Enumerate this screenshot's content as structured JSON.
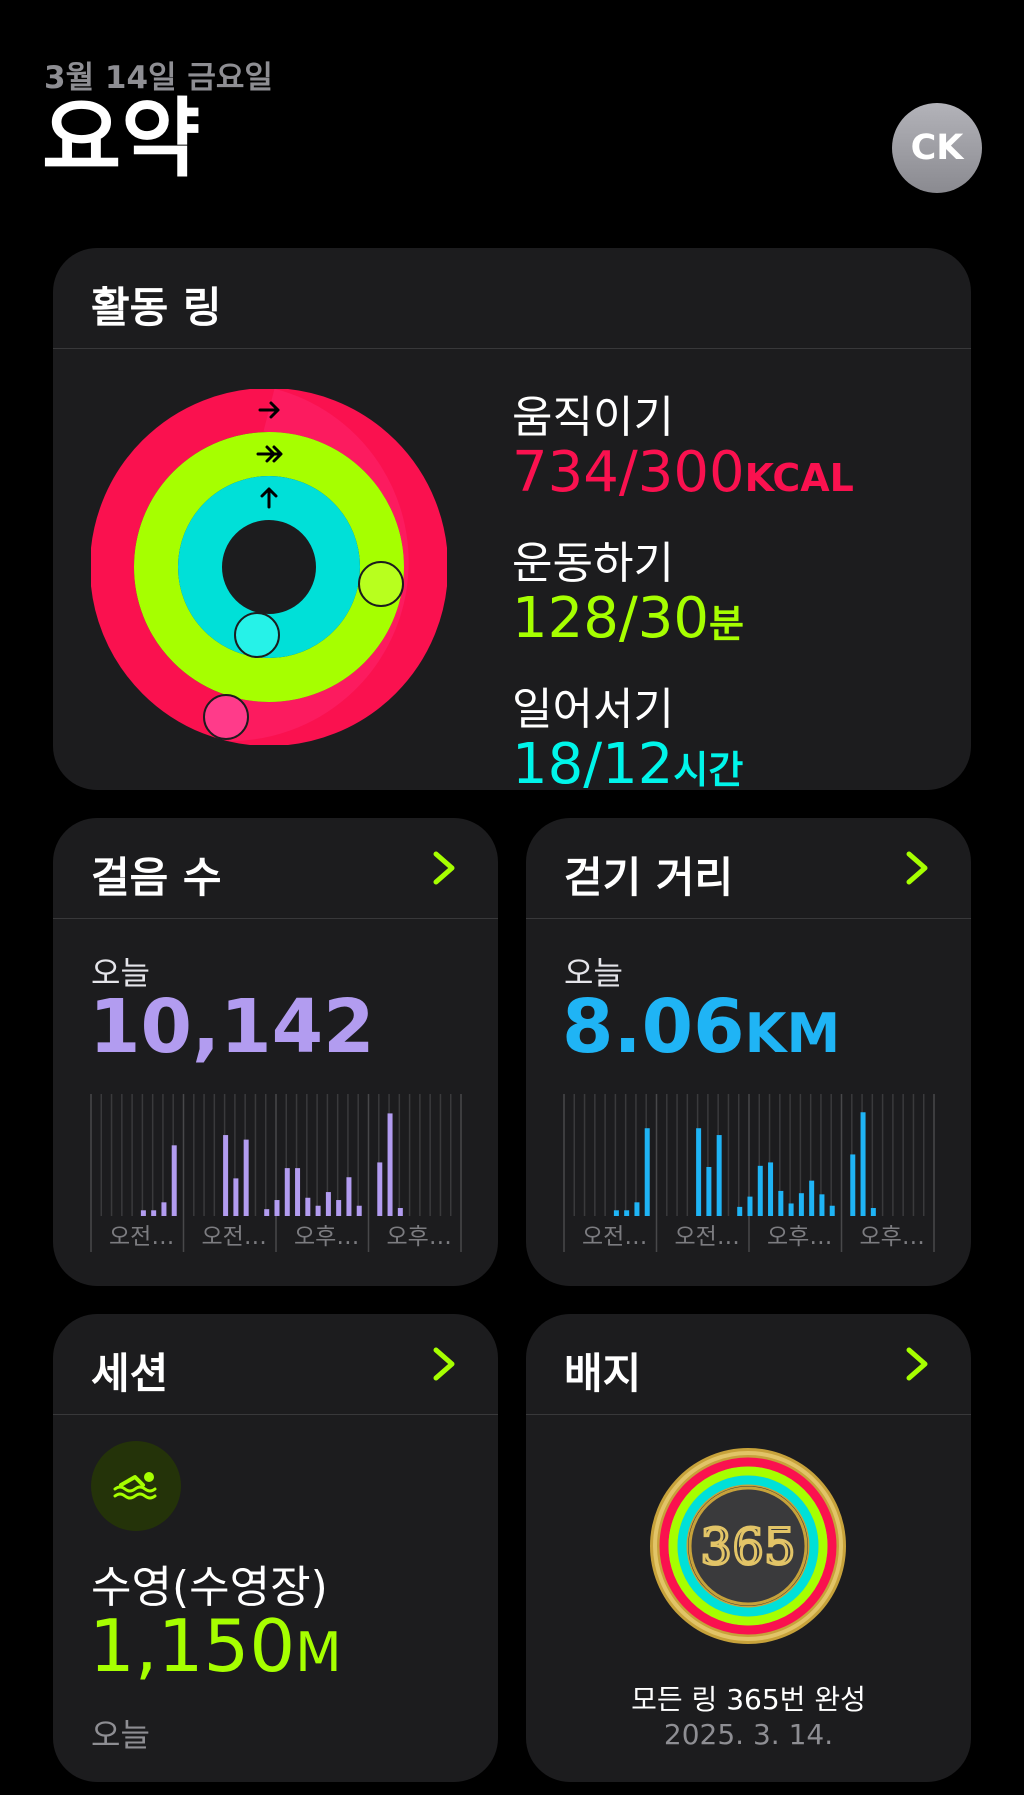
{
  "header": {
    "date": "3월 14일 금요일",
    "title": "요약",
    "avatar_initials": "CK"
  },
  "activity": {
    "title": "활동 링",
    "move": {
      "label": "움직이기",
      "value": "734/300",
      "unit": "KCAL",
      "color": "#fa114f",
      "progress": 2.45
    },
    "exercise": {
      "label": "운동하기",
      "value": "128/30",
      "unit": "분",
      "color": "#a6ff00",
      "progress": 4.27
    },
    "stand": {
      "label": "일어서기",
      "value": "18/12",
      "unit": "시간",
      "color": "#00f5ea",
      "progress": 1.5
    }
  },
  "steps": {
    "title": "걸음 수",
    "today_label": "오늘",
    "value": "10,142",
    "color": "#b29cf0",
    "axis_labels": [
      "오전…",
      "오전…",
      "오후…",
      "오후…"
    ],
    "hourly": [
      0,
      0,
      0,
      0,
      0,
      0.05,
      0.05,
      0.12,
      0.62,
      0,
      0,
      0,
      0,
      0.71,
      0.33,
      0.67,
      0,
      0.06,
      0.14,
      0.42,
      0.42,
      0.16,
      0.09,
      0.21,
      0.14,
      0.34,
      0.09,
      0,
      0.47,
      0.9,
      0.07,
      0,
      0,
      0,
      0,
      0,
      0
    ]
  },
  "distance": {
    "title": "걷기 거리",
    "today_label": "오늘",
    "value": "8.06",
    "unit": "KM",
    "color": "#1fb4f5",
    "axis_labels": [
      "오전…",
      "오전…",
      "오후…",
      "오후…"
    ],
    "hourly": [
      0,
      0,
      0,
      0,
      0,
      0.05,
      0.05,
      0.12,
      0.77,
      0,
      0,
      0,
      0,
      0.77,
      0.43,
      0.71,
      0,
      0.08,
      0.17,
      0.44,
      0.47,
      0.22,
      0.11,
      0.2,
      0.31,
      0.19,
      0.09,
      0,
      0.54,
      0.91,
      0.07,
      0,
      0,
      0,
      0,
      0,
      0
    ]
  },
  "sessions": {
    "title": "세션",
    "activity_name": "수영(수영장)",
    "value": "1,150",
    "unit": "M",
    "time_label": "오늘",
    "color": "#a6ff00",
    "icon": "pool-swim-icon"
  },
  "badges": {
    "title": "배지",
    "badge_name": "모든 링 365번 완성",
    "badge_date": "2025. 3. 14.",
    "badge_text": "365"
  }
}
